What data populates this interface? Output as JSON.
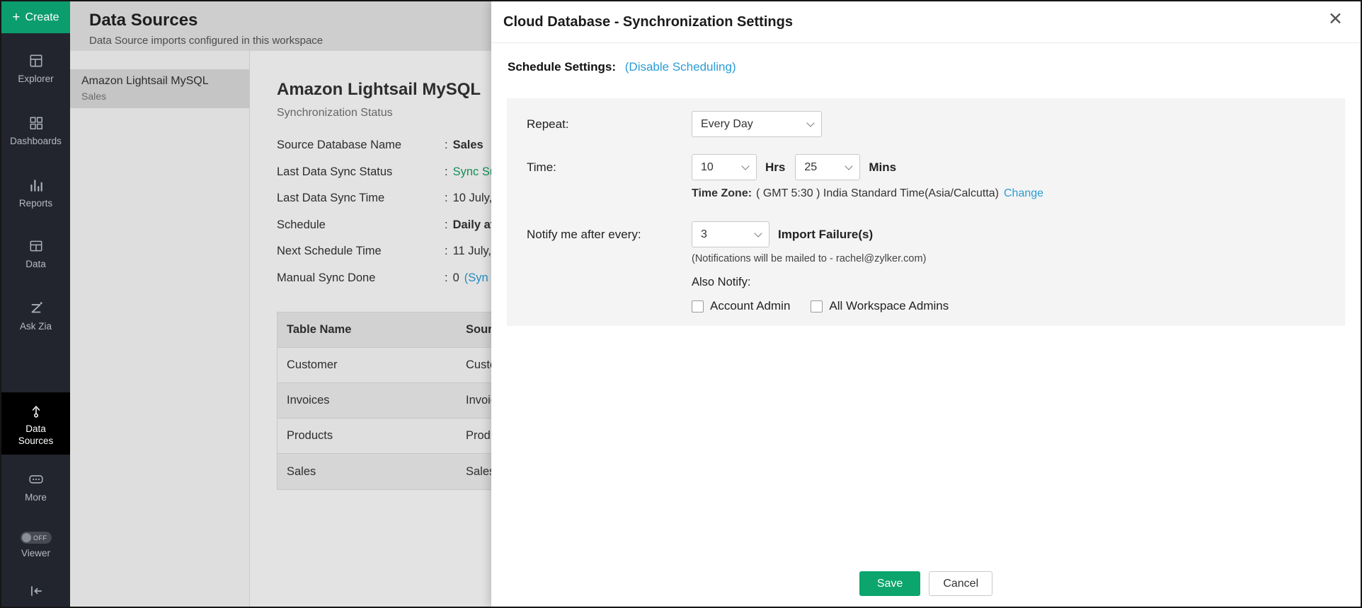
{
  "sidebar": {
    "create_label": "Create",
    "items": [
      {
        "label": "Explorer"
      },
      {
        "label": "Dashboards"
      },
      {
        "label": "Reports"
      },
      {
        "label": "Data"
      },
      {
        "label": "Ask Zia"
      },
      {
        "label": "Data Sources"
      },
      {
        "label": "More"
      }
    ],
    "viewer_toggle": "OFF",
    "viewer_label": "Viewer"
  },
  "main": {
    "title": "Data Sources",
    "subtitle": "Data Source imports configured in this workspace",
    "source_item": {
      "name": "Amazon Lightsail MySQL",
      "subtitle": "Sales"
    },
    "detail": {
      "title": "Amazon Lightsail MySQL",
      "subtitle": "Synchronization Status",
      "colon": ":",
      "fields": [
        {
          "label": "Source Database Name",
          "value": "Sales"
        },
        {
          "label": "Last Data Sync Status",
          "value": "Sync Su"
        },
        {
          "label": "Last Data Sync Time",
          "value": "10 July,"
        },
        {
          "label": "Schedule",
          "value": "Daily at"
        },
        {
          "label": "Next Schedule Time",
          "value": "11 July,"
        },
        {
          "label": "Manual Sync Done",
          "value": "0",
          "link": "(Syn"
        }
      ],
      "table": {
        "headers": [
          "Table Name",
          "Sourc"
        ],
        "rows": [
          [
            "Customer",
            "Custo"
          ],
          [
            "Invoices",
            "Invoic"
          ],
          [
            "Products",
            "Produ"
          ],
          [
            "Sales",
            "Sales"
          ]
        ]
      }
    }
  },
  "modal": {
    "title": "Cloud Database - Synchronization Settings",
    "close_glyph": "✕",
    "schedule_settings_label": "Schedule Settings:",
    "disable_link": "(Disable Scheduling)",
    "repeat_label": "Repeat:",
    "repeat_value": "Every Day",
    "time_label": "Time:",
    "hours_value": "10",
    "hours_unit": "Hrs",
    "minutes_value": "25",
    "minutes_unit": "Mins",
    "timezone_label": "Time Zone:",
    "timezone_value": "( GMT 5:30 ) India Standard Time(Asia/Calcutta)",
    "timezone_change": "Change",
    "notify_label": "Notify me after every:",
    "notify_value": "3",
    "notify_unit": "Import Failure(s)",
    "notify_note": "(Notifications will be mailed to - rachel@zylker.com)",
    "also_notify_label": "Also Notify:",
    "checkbox_account_admin": "Account Admin",
    "checkbox_workspace_admins": "All Workspace Admins",
    "save_label": "Save",
    "cancel_label": "Cancel"
  },
  "colors": {
    "accent_green": "#0ba56d",
    "link_blue": "#2a9cd6",
    "sync_status_green": "#12a263",
    "sidebar_dark": "#22252e"
  }
}
